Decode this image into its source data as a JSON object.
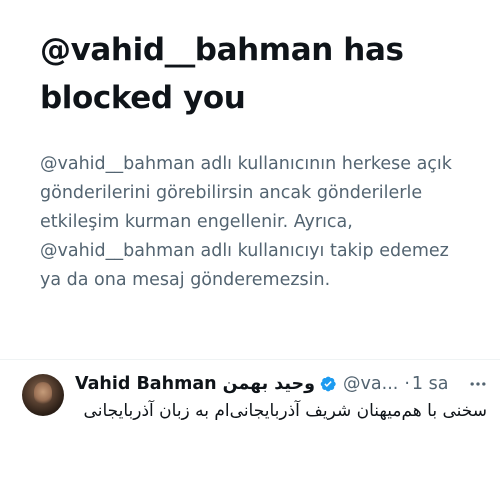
{
  "blocked": {
    "title": "@vahid__bahman has blocked you",
    "description": "@vahid__bahman adlı kullanıcının herkese açık gönderilerini görebilirsin ancak gönderilerle etkileşim kurman engellenir. Ayrıca, @vahid__bahman adlı kullanıcıyı takip edemez ya da ona mesaj gönderemezsin."
  },
  "post": {
    "display_name": "Vahid Bahman",
    "display_name_fa": "وحید بهمن",
    "handle": "@va...",
    "separator": "·",
    "timestamp": "1 sa",
    "text": "سخنی با هم‌میهنان شریف آذربایجانی‌ام به زبان آذربایجانی",
    "verified_color": "#1d9bf0"
  },
  "icons": {
    "verified": "verified-badge-icon",
    "more": "more-horizontal-icon"
  }
}
